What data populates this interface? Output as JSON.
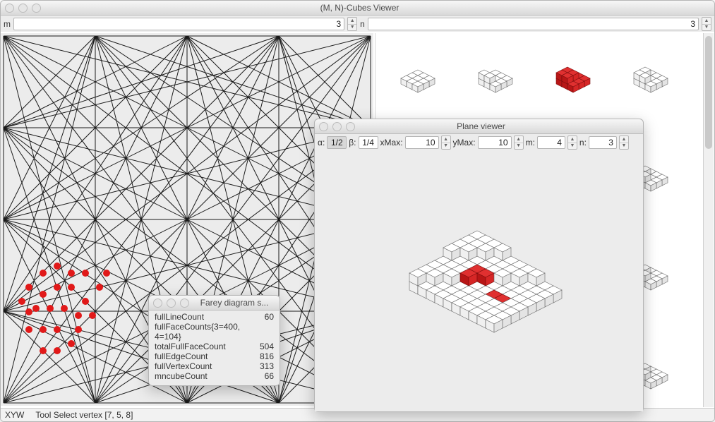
{
  "mainWindow": {
    "title": "(M, N)-Cubes Viewer",
    "toolbar": {
      "m_label": "m",
      "m_value": "3",
      "n_label": "n",
      "n_value": "3"
    },
    "status": {
      "mode": "XYW",
      "tool": "Tool Select vertex [7, 5, 8]"
    }
  },
  "stats": {
    "title": "Farey diagram s...",
    "rows": [
      {
        "label": "fullLineCount",
        "value": "60"
      },
      {
        "label": "fullFaceCounts{3=400, 4=104}",
        "value": ""
      },
      {
        "label": "totalFullFaceCount",
        "value": "504"
      },
      {
        "label": "fullEdgeCount",
        "value": "816"
      },
      {
        "label": "fullVertexCount",
        "value": "313"
      },
      {
        "label": "mncubeCount",
        "value": "66"
      }
    ]
  },
  "planeViewer": {
    "title": "Plane viewer",
    "toolbar": {
      "alpha_label": "α:",
      "alpha_value": "1/2",
      "beta_label": "β:",
      "beta_value": "1/4",
      "xmax_label": "xMax:",
      "xmax_value": "10",
      "ymax_label": "yMax:",
      "ymax_value": "10",
      "m_label": "m:",
      "m_value": "4",
      "n_label": "n:",
      "n_value": "3"
    }
  },
  "colors": {
    "highlight": "#e11919",
    "grid": "#1a1a1a",
    "cube_fill": "#ffffff",
    "cube_stroke": "#666666",
    "red_top": "#e03030",
    "red_left": "#b81616",
    "red_right": "#d62626"
  }
}
